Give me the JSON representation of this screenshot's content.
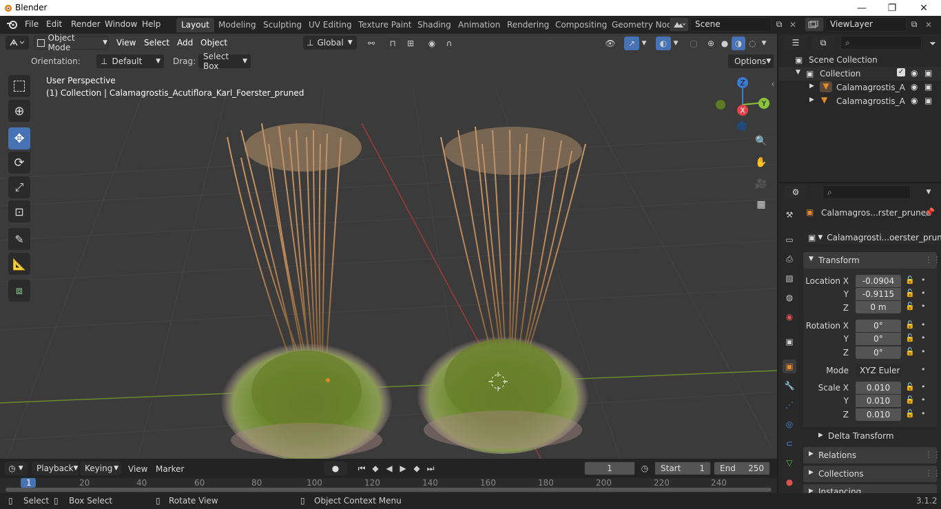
{
  "titlebar": {
    "app_title": "Blender",
    "minimize": "—",
    "restore": "❐",
    "close": "✕"
  },
  "menus": [
    "File",
    "Edit",
    "Render",
    "Window",
    "Help"
  ],
  "workspaces": [
    "Layout",
    "Modeling",
    "Sculpting",
    "UV Editing",
    "Texture Paint",
    "Shading",
    "Animation",
    "Rendering",
    "Compositing",
    "Geometry Nod"
  ],
  "scene": {
    "name": "Scene",
    "view_layer": "ViewLayer"
  },
  "viewport_header": {
    "mode": "Object Mode",
    "menus": [
      "View",
      "Select",
      "Add",
      "Object"
    ],
    "transform_orientation": "Global"
  },
  "tool_settings": {
    "orientation_label": "Orientation:",
    "orientation_value": "Default",
    "drag_label": "Drag:",
    "drag_value": "Select Box",
    "options": "Options"
  },
  "viewport": {
    "view_name": "User Perspective",
    "collection_info": "(1) Collection | Calamagrostis_Acutiflora_Karl_Foerster_pruned",
    "gizmo": {
      "x": "X",
      "y": "Y",
      "z": "Z"
    }
  },
  "outliner": {
    "root": "Scene Collection",
    "collection": "Collection",
    "objects": [
      "Calamagrostis_A",
      "Calamagrostis_A"
    ]
  },
  "properties": {
    "object_name": "Calamagros...rster_pruned",
    "data_name": "Calamagrosti...oerster_pruned",
    "transform_title": "Transform",
    "location_label": "Location X",
    "location": [
      "-0.0904",
      "-0.9115",
      "0 m"
    ],
    "rotation_label": "Rotation X",
    "rotation": [
      "0°",
      "0°",
      "0°"
    ],
    "mode_label": "Mode",
    "rotation_mode": "XYZ Euler",
    "scale_label": "Scale X",
    "scale": [
      "0.010",
      "0.010",
      "0.010"
    ],
    "axis_y": "Y",
    "axis_z": "Z",
    "delta_transform": "Delta Transform",
    "sections": [
      "Relations",
      "Collections",
      "Instancing"
    ]
  },
  "timeline": {
    "menus": [
      "Playback",
      "Keying",
      "View",
      "Marker"
    ],
    "current_frame": "1",
    "start_label": "Start",
    "start": "1",
    "end_label": "End",
    "end": "250",
    "ruler": [
      "1",
      "20",
      "40",
      "60",
      "80",
      "100",
      "120",
      "140",
      "160",
      "180",
      "200",
      "220",
      "240"
    ]
  },
  "statusbar": {
    "items": [
      "Select",
      "Box Select",
      "Rotate View",
      "Object Context Menu"
    ],
    "version": "3.1.2"
  },
  "colors": {
    "accent": "#4772b3",
    "axis_x": "#e8414a",
    "axis_y": "#8bc43a",
    "axis_z": "#3a7bd5",
    "active_object": "#e58a2c"
  }
}
